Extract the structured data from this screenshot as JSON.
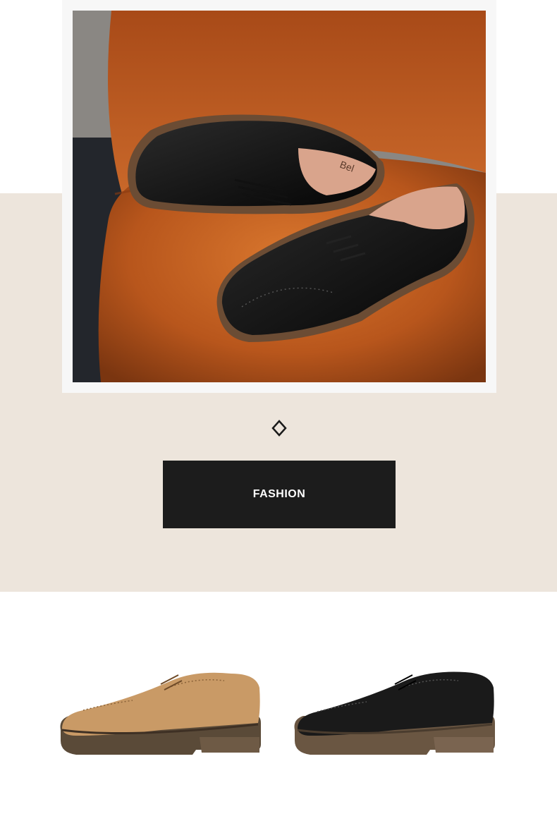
{
  "banner": {
    "photo_label": "black-brogue-shoes-on-leather-chair",
    "brand_imprint": "Bel"
  },
  "divider": {
    "icon": "diamond-outline-icon"
  },
  "cta": {
    "label": "FASHION"
  },
  "products": [
    {
      "name": "tan-brogue-oxford",
      "color": "#c99a66"
    },
    {
      "name": "black-brogue-oxford",
      "color": "#1a1a1a"
    }
  ],
  "colors": {
    "band": "#ede5dc",
    "button": "#1c1c1c",
    "leather_chair": "#c0601f"
  }
}
